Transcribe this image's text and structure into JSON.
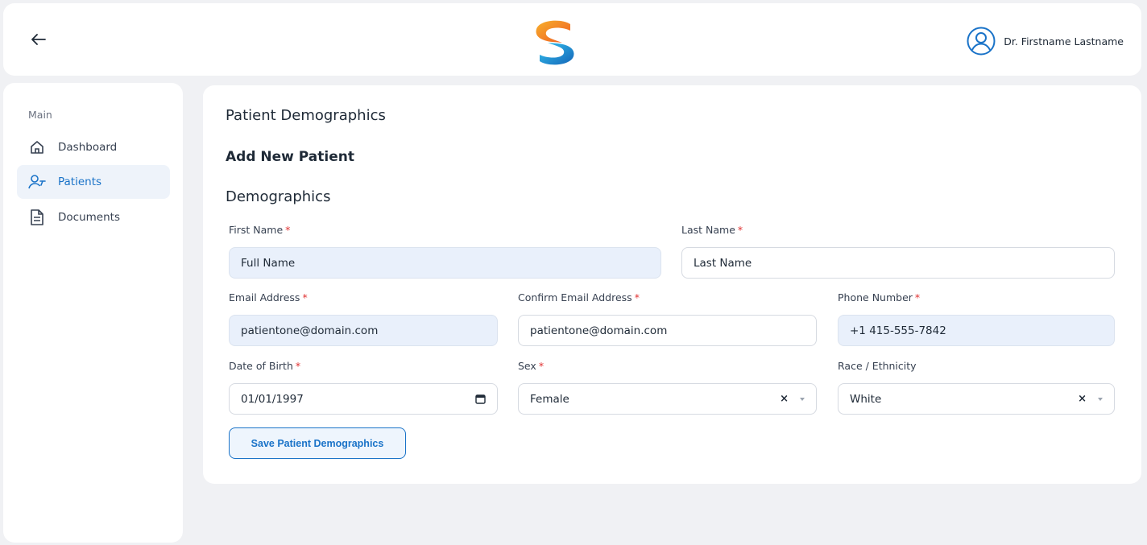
{
  "header": {
    "user_name": "Dr. Firstname Lastname",
    "back_icon": "arrow-left-icon",
    "user_icon": "user-circle-icon"
  },
  "sidebar": {
    "section_label": "Main",
    "items": [
      {
        "label": "Dashboard",
        "icon": "home-icon",
        "active": false
      },
      {
        "label": "Patients",
        "icon": "user-add-icon",
        "active": true
      },
      {
        "label": "Documents",
        "icon": "document-icon",
        "active": false
      }
    ]
  },
  "main": {
    "page_title": "Patient Demographics",
    "sub_title": "Add New Patient",
    "section_title": "Demographics",
    "fields": {
      "first_name": {
        "label": "First Name",
        "value": "Full Name"
      },
      "last_name": {
        "label": "Last Name",
        "value": "Last Name"
      },
      "email": {
        "label": "Email Address",
        "value": "patientone@domain.com"
      },
      "confirm_email": {
        "label": "Confirm Email Address",
        "value": "patientone@domain.com"
      },
      "phone": {
        "label": "Phone Number",
        "value": "+1 415-555-7842"
      },
      "dob": {
        "label": "Date of Birth",
        "value": "01/01/1997"
      },
      "sex": {
        "label": "Sex",
        "value": "Female"
      },
      "race": {
        "label": "Race / Ethnicity",
        "value": "White"
      }
    },
    "required_marker": "*",
    "clear_glyph": "×",
    "save_label": "Save Patient Demographics"
  },
  "colors": {
    "accent": "#1a73c8",
    "required": "#e03131",
    "filled_field": "#e9f0fb",
    "page_bg": "#f0f1f4"
  }
}
